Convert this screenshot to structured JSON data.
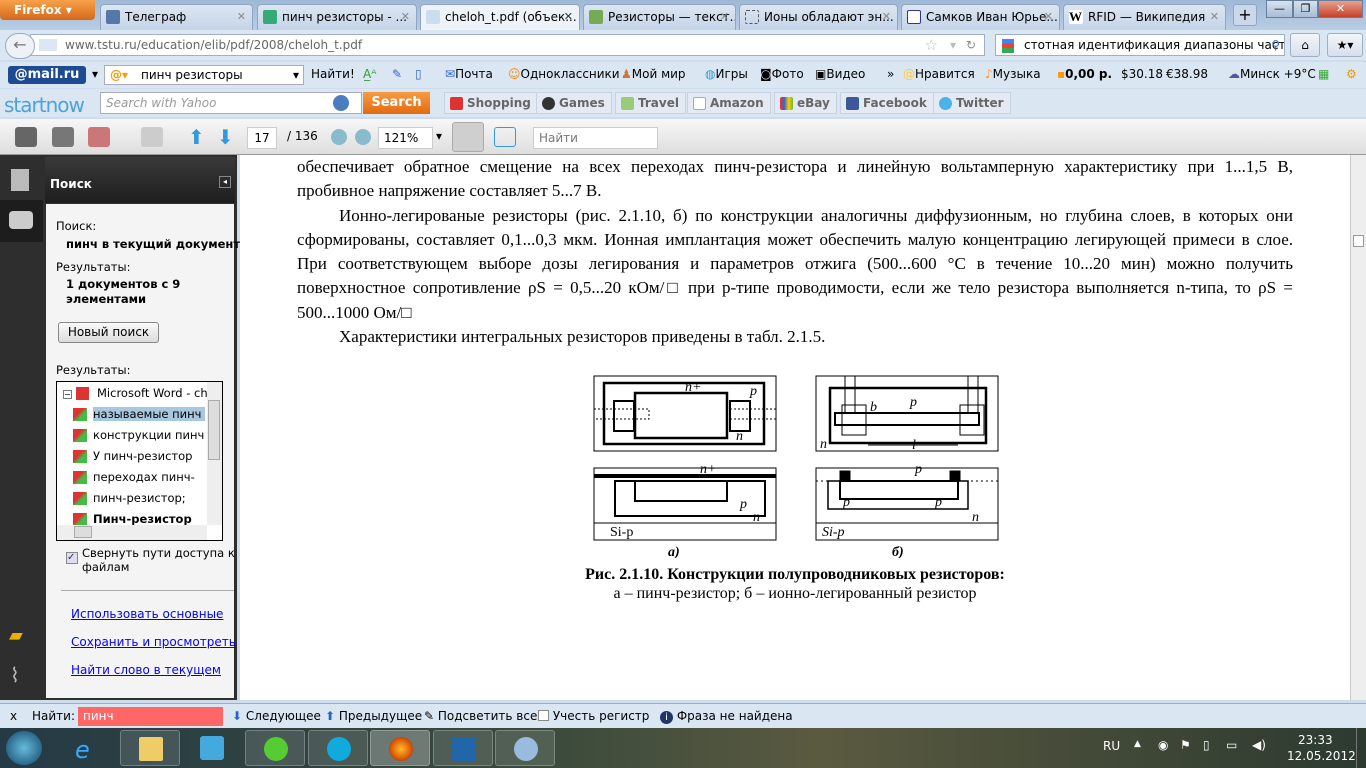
{
  "browser": {
    "menu_button": "Firefox",
    "tabs": [
      {
        "title": "Телеграф"
      },
      {
        "title": "пинч резисторы - ..."
      },
      {
        "title": "cheloh_t.pdf (объек..."
      },
      {
        "title": "Резисторы — текст..."
      },
      {
        "title": "Ионы обладают эн..."
      },
      {
        "title": "Самков Иван Юрье..."
      },
      {
        "title": "RFID — Википедия"
      }
    ],
    "new_tab": "+",
    "url": "www.tstu.ru/education/elib/pdf/2008/cheloh_t.pdf",
    "search_value": "стотная идентификация диапазоны частот"
  },
  "mailru": {
    "logo": "@mail.ru",
    "query": "пинч резисторы",
    "find": "Найти!",
    "items": [
      "Почта",
      "Одноклассники",
      "Мой мир",
      "Игры",
      "Фото",
      "Видео",
      "»",
      "Нравится",
      "Музыка",
      "0,00 р.",
      "$30.18",
      "€38.98",
      "Минск +9°C"
    ]
  },
  "startnow": {
    "logo": "startnow",
    "placeholder": "Search with Yahoo",
    "search": "Search",
    "buttons": [
      "Shopping",
      "Games",
      "Travel",
      "Amazon",
      "eBay",
      "Facebook",
      "Twitter"
    ]
  },
  "pdf_toolbar": {
    "page": "17",
    "total": "/ 136",
    "zoom": "121%",
    "find_placeholder": "Найти"
  },
  "search_panel": {
    "title": "Поиск",
    "search_label": "Поиск:",
    "search_value": "пинч в текущий документ",
    "results_label": "Результаты:",
    "results_value_1": "1 документов с 9",
    "results_value_2": "элементами",
    "new_search": "Новый поиск",
    "results_label2": "Результаты:",
    "tree_root": "Microsoft Word - ch",
    "tree_items": [
      "называемые пинч",
      "конструкции пинч",
      "У пинч-резистор",
      "переходах пинч-",
      "пинч-резистор;",
      "Пинч-резистор"
    ],
    "collapse_paths_1": "Свернуть пути доступа к",
    "collapse_paths_2": "файлам",
    "links": [
      "Использовать основные",
      "Сохранить и просмотреть",
      "Найти слово в текущем"
    ]
  },
  "document": {
    "p1": "обеспечивает обратное смещение на всех переходах пинч-резистора и линейную вольтамперную характеристику при 1...1,5 В, пробивное напряжение составляет 5...7 В.",
    "p2": "Ионно-легированые резисторы (рис. 2.1.10, б) по конструкции аналогичны диффузионным, но глубина слоев, в которых они сформированы, составляет 0,1...0,3 мкм. Ионная имплантация может обеспечить малую концентрацию легирующей примеси в слое. При соответствующем выборе дозы легирования и параметров отжига (500...600 °С в течение 10...20 мин) можно получить поверхностное сопротивление ρS = 0,5...20 кОм/□ при p-типе проводимости, если же тело резистора выполняется n-типа, то ρS = 500...1000 Ом/□",
    "p3": "Характеристики интегральных резисторов приведены в табл. 2.1.5.",
    "figure_labels": {
      "a": "а)",
      "b": "б)",
      "n_plus": "n+",
      "p": "p",
      "n": "n",
      "sip": "Si-p",
      "l": "l",
      "b_dim": "b"
    },
    "caption_1": "Рис. 2.1.10. Конструкции полупроводниковых резисторов:",
    "caption_2": "а – пинч-резистор; б – ионно-легированный резистор"
  },
  "findbar": {
    "close": "x",
    "label": "Найти:",
    "value": "пинч",
    "next": "Следующее",
    "prev": "Предыдущее",
    "highlight": "Подсветить все",
    "match_case": "Учесть регистр",
    "status": "Фраза не найдена"
  },
  "taskbar": {
    "lang": "RU",
    "time": "23:33",
    "date": "12.05.2012"
  }
}
